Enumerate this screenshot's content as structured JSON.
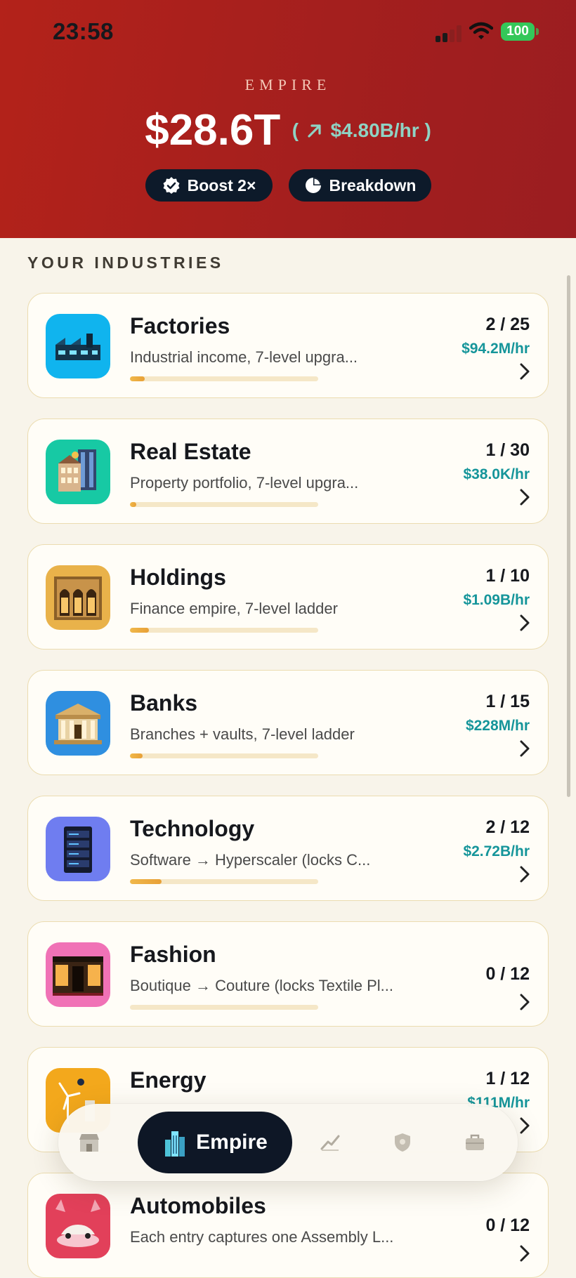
{
  "status_bar": {
    "time": "23:58",
    "battery": "100"
  },
  "header": {
    "label": "EMPIRE",
    "total": "$28.6T",
    "rate_open": "(",
    "rate": "$4.80B/hr",
    "rate_close": ")",
    "boost_label": "Boost 2×",
    "breakdown_label": "Breakdown",
    "icons": {
      "boost": "verified-badge-icon",
      "breakdown": "pie-chart-icon",
      "rate": "arrow-up-right-icon"
    }
  },
  "section_title": "YOUR INDUSTRIES",
  "industries": [
    {
      "name": "Factories",
      "description": "Industrial income, 7-level upgra...",
      "count": "2 / 25",
      "rate": "$94.2M/hr",
      "progress": 0.08,
      "tile_color": "#10b4ee",
      "icon": "factory-icon"
    },
    {
      "name": "Real Estate",
      "description": "Property portfolio, 7-level upgra...",
      "count": "1 / 30",
      "rate": "$38.0K/hr",
      "progress": 0.033,
      "tile_color": "#17c9a4",
      "icon": "buildings-icon"
    },
    {
      "name": "Holdings",
      "description": "Finance empire, 7-level ladder",
      "count": "1 / 10",
      "rate": "$1.09B/hr",
      "progress": 0.1,
      "tile_color": "#e9b24a",
      "icon": "holdings-building-icon"
    },
    {
      "name": "Banks",
      "description": "Branches + vaults, 7-level ladder",
      "count": "1 / 15",
      "rate": "$228M/hr",
      "progress": 0.067,
      "tile_color": "#2f8fe0",
      "icon": "bank-icon"
    },
    {
      "name": "Technology",
      "description": "Software → Hyperscaler (locks C...",
      "count": "2 / 12",
      "rate": "$2.72B/hr",
      "progress": 0.167,
      "tile_color": "#6f7df0",
      "icon": "server-rack-icon"
    },
    {
      "name": "Fashion",
      "description": "Boutique → Couture (locks Textile Pl...",
      "count": "0 / 12",
      "rate": "",
      "progress": 0,
      "tile_color": "#f072b6",
      "icon": "boutique-icon"
    },
    {
      "name": "Energy",
      "description": "",
      "count": "1 / 12",
      "rate": "$111M/hr",
      "progress": 0.083,
      "tile_color": "#f3a81c",
      "icon": "wind-turbine-icon"
    },
    {
      "name": "Automobiles",
      "description": "Each entry captures one Assembly L...",
      "count": "0 / 12",
      "rate": "",
      "progress": 0,
      "tile_color": "#e2405a",
      "icon": "car-icon"
    }
  ],
  "nav": {
    "active_label": "Empire",
    "items": [
      "shop-icon",
      "empire-skyline-icon",
      "stocks-chart-icon",
      "shield-icon",
      "briefcase-icon"
    ]
  }
}
